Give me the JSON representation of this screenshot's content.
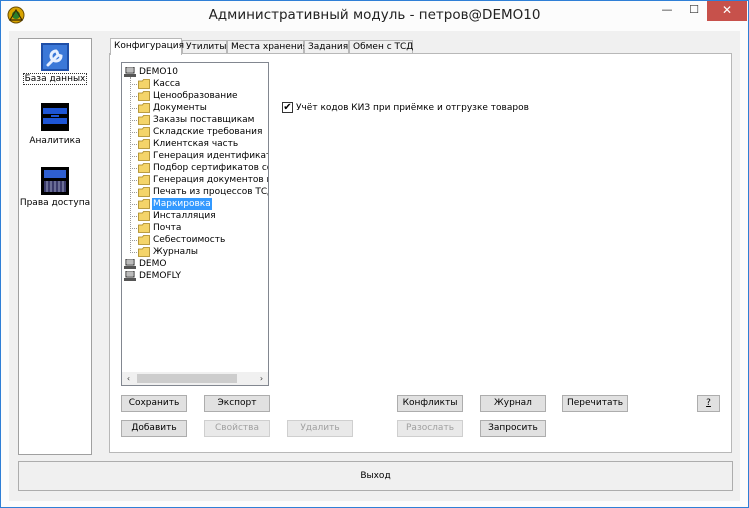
{
  "window": {
    "title": "Административный модуль - петров@DEMO10",
    "minimize_label": "—",
    "maximize_label": "☐",
    "close_label": "✕"
  },
  "sidebar": {
    "items": [
      {
        "label": "База данных",
        "icon": "wrench-icon"
      },
      {
        "label": "Аналитика",
        "icon": "analytics-icon"
      },
      {
        "label": "Права доступа",
        "icon": "access-rights-icon"
      }
    ]
  },
  "tabs": [
    {
      "label": "Конфигурация"
    },
    {
      "label": "Утилиты"
    },
    {
      "label": "Места хранения"
    },
    {
      "label": "Задания"
    },
    {
      "label": "Обмен с ТСД"
    }
  ],
  "tree": {
    "roots": [
      {
        "label": "DEMO10",
        "children": [
          {
            "label": "Касса"
          },
          {
            "label": "Ценообразование"
          },
          {
            "label": "Документы"
          },
          {
            "label": "Заказы поставщикам"
          },
          {
            "label": "Складские требования"
          },
          {
            "label": "Клиентская часть"
          },
          {
            "label": "Генерация идентификатор"
          },
          {
            "label": "Подбор сертификатов соо"
          },
          {
            "label": "Генерация документов из"
          },
          {
            "label": "Печать из процессов ТСД"
          },
          {
            "label": "Маркировка"
          },
          {
            "label": "Инсталляция"
          },
          {
            "label": "Почта"
          },
          {
            "label": "Себестоимость"
          },
          {
            "label": "Журналы"
          }
        ]
      },
      {
        "label": "DEMO",
        "children": []
      },
      {
        "label": "DEMOFLY",
        "children": []
      }
    ],
    "selected": "Маркировка",
    "scroll_left": "‹",
    "scroll_right": "›"
  },
  "settings": {
    "kiz_checkbox_label": "Учёт кодов КИЗ при приёмке и отгрузке товаров",
    "kiz_checked": true,
    "check_mark": "✔"
  },
  "buttons": {
    "save": "Сохранить",
    "export": "Экспорт",
    "conflicts": "Конфликты",
    "journal": "Журнал",
    "reread": "Перечитать",
    "help": "?",
    "add": "Добавить",
    "properties": "Свойства",
    "delete": "Удалить",
    "send": "Разослать",
    "request": "Запросить"
  },
  "exit_label": "Выход",
  "colors": {
    "selection": "#3399ff",
    "close_button": "#c7514b",
    "window_border": "#2f7fd6"
  }
}
